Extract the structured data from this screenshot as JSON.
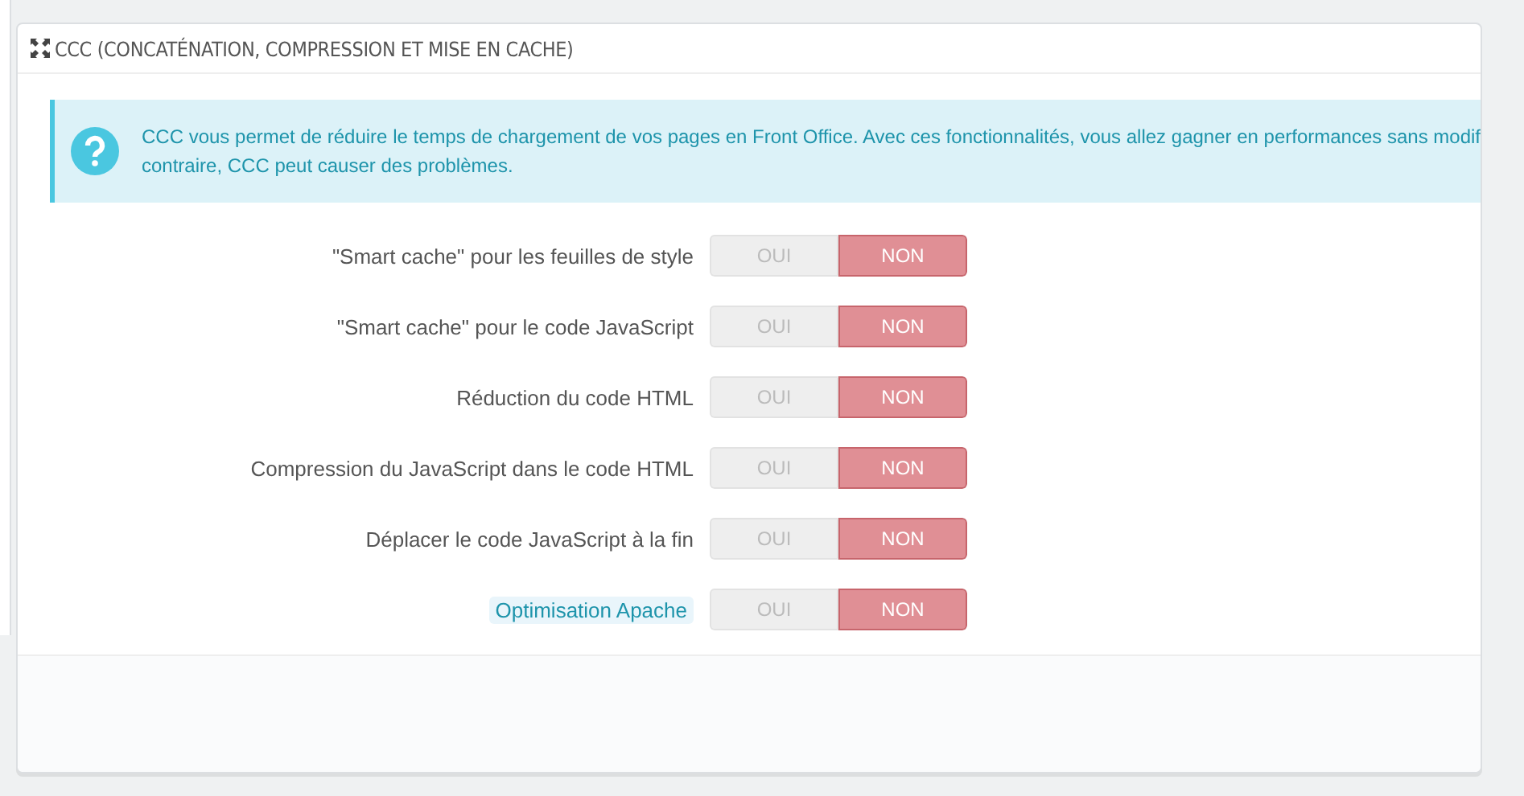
{
  "panel": {
    "title": "CCC (CONCATÉNATION, COMPRESSION ET MISE EN CACHE)"
  },
  "alert": {
    "lines": [
      "CCC vous permet de réduire le temps de chargement de vos pages en Front Office. Avec ces fonctionnalités, vous allez gagner en performances sans modif",
      "contraire, CCC peut causer des problèmes."
    ]
  },
  "options": [
    {
      "label": "\"Smart cache\" pour les feuilles de style",
      "kind": "plain",
      "yes": "OUI",
      "no": "NON",
      "on": false
    },
    {
      "label": "\"Smart cache\" pour le code JavaScript",
      "kind": "plain",
      "yes": "OUI",
      "no": "NON",
      "on": false
    },
    {
      "label": "Réduction du code HTML",
      "kind": "plain",
      "yes": "OUI",
      "no": "NON",
      "on": false
    },
    {
      "label": "Compression du JavaScript dans le code HTML",
      "kind": "plain",
      "yes": "OUI",
      "no": "NON",
      "on": false
    },
    {
      "label": "Déplacer le code JavaScript à la fin",
      "kind": "plain",
      "yes": "OUI",
      "no": "NON",
      "on": false
    },
    {
      "label": "Optimisation Apache",
      "kind": "hint",
      "yes": "OUI",
      "no": "NON",
      "on": false
    }
  ]
}
